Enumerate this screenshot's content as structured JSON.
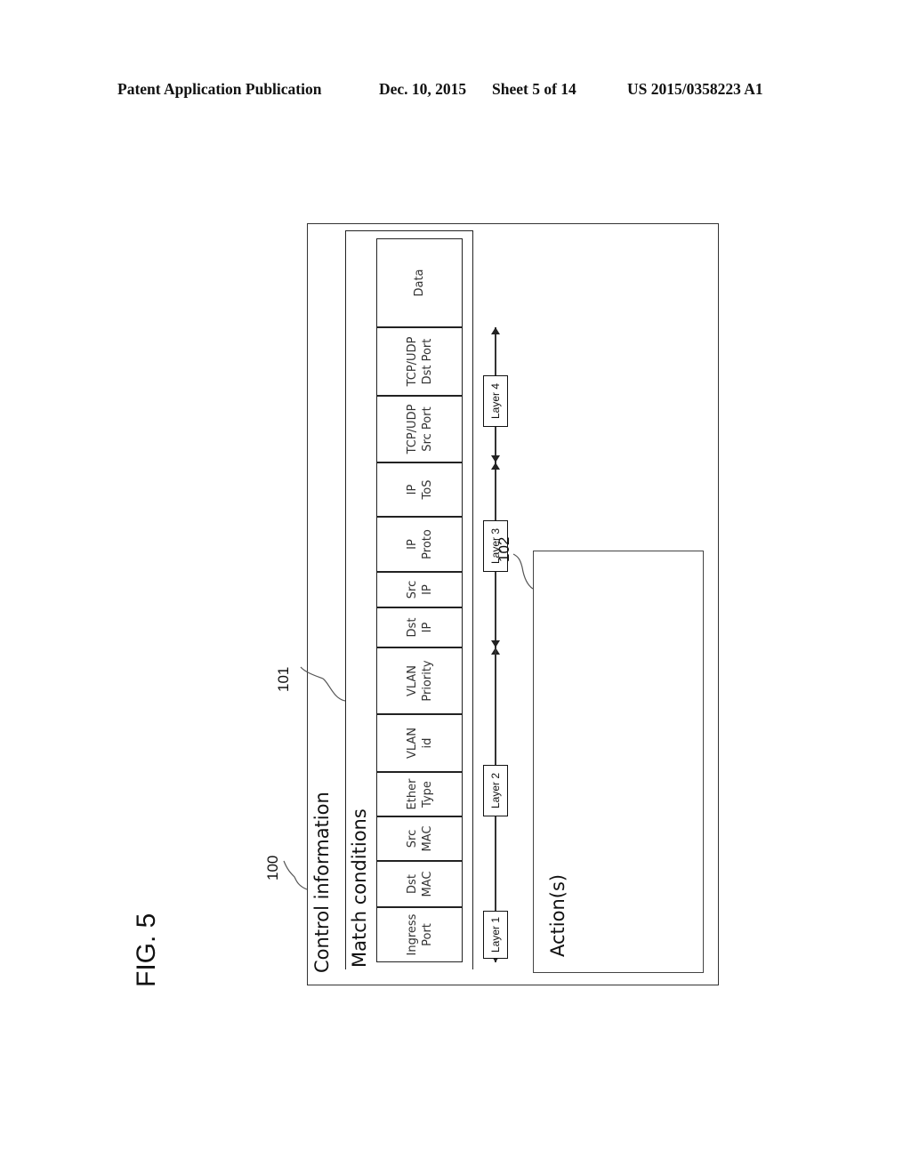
{
  "header": {
    "publication": "Patent Application Publication",
    "date": "Dec. 10, 2015",
    "sheet": "Sheet 5 of 14",
    "number": "US 2015/0358223 A1"
  },
  "figure": {
    "label": "FIG. 5",
    "control_information": {
      "ref": "100",
      "title": "Control information"
    },
    "match_conditions": {
      "ref": "101",
      "title": "Match conditions",
      "fields": [
        {
          "line1": "Ingress",
          "line2": "Port"
        },
        {
          "line1": "Dst",
          "line2": "MAC"
        },
        {
          "line1": "Src",
          "line2": "MAC"
        },
        {
          "line1": "Ether",
          "line2": "Type"
        },
        {
          "line1": "VLAN",
          "line2": "id"
        },
        {
          "line1": "VLAN",
          "line2": "Priority"
        },
        {
          "line1": "Dst",
          "line2": "IP"
        },
        {
          "line1": "Src",
          "line2": "IP"
        },
        {
          "line1": "IP",
          "line2": "Proto"
        },
        {
          "line1": "IP",
          "line2": "ToS"
        },
        {
          "line1": "TCP/UDP",
          "line2": "Src Port"
        },
        {
          "line1": "TCP/UDP",
          "line2": "Dst Port"
        },
        {
          "line1": "Data",
          "line2": ""
        }
      ]
    },
    "layers": [
      "Layer 1",
      "Layer 2",
      "Layer 3",
      "Layer 4"
    ],
    "actions": {
      "ref": "102",
      "title": "Action(s)"
    }
  }
}
